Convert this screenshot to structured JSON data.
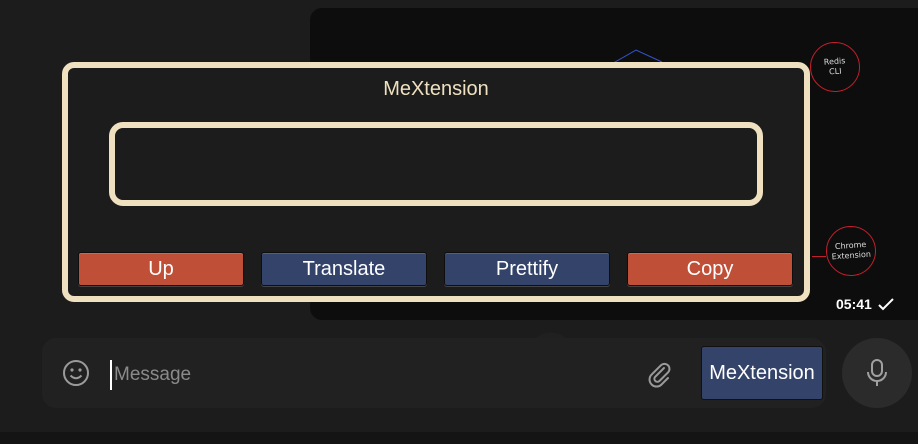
{
  "extension": {
    "title": "MeXtension",
    "textarea_value": "",
    "buttons": {
      "up": "Up",
      "translate": "Translate",
      "prettify": "Prettify",
      "copy": "Copy"
    },
    "colors": {
      "frame": "#efe0c0",
      "accent_red": "#bf5037",
      "accent_blue": "#34436a"
    }
  },
  "message": {
    "timestamp": "05:41",
    "status_icon": "check-icon",
    "diagram_nodes": [
      "Redis\nCLI",
      "Chrome\nExtension"
    ]
  },
  "composer": {
    "placeholder": "Message",
    "emoji_icon": "emoji-icon",
    "attach_icon": "paperclip-icon",
    "extension_button": "MeXtension",
    "mic_icon": "microphone-icon"
  }
}
